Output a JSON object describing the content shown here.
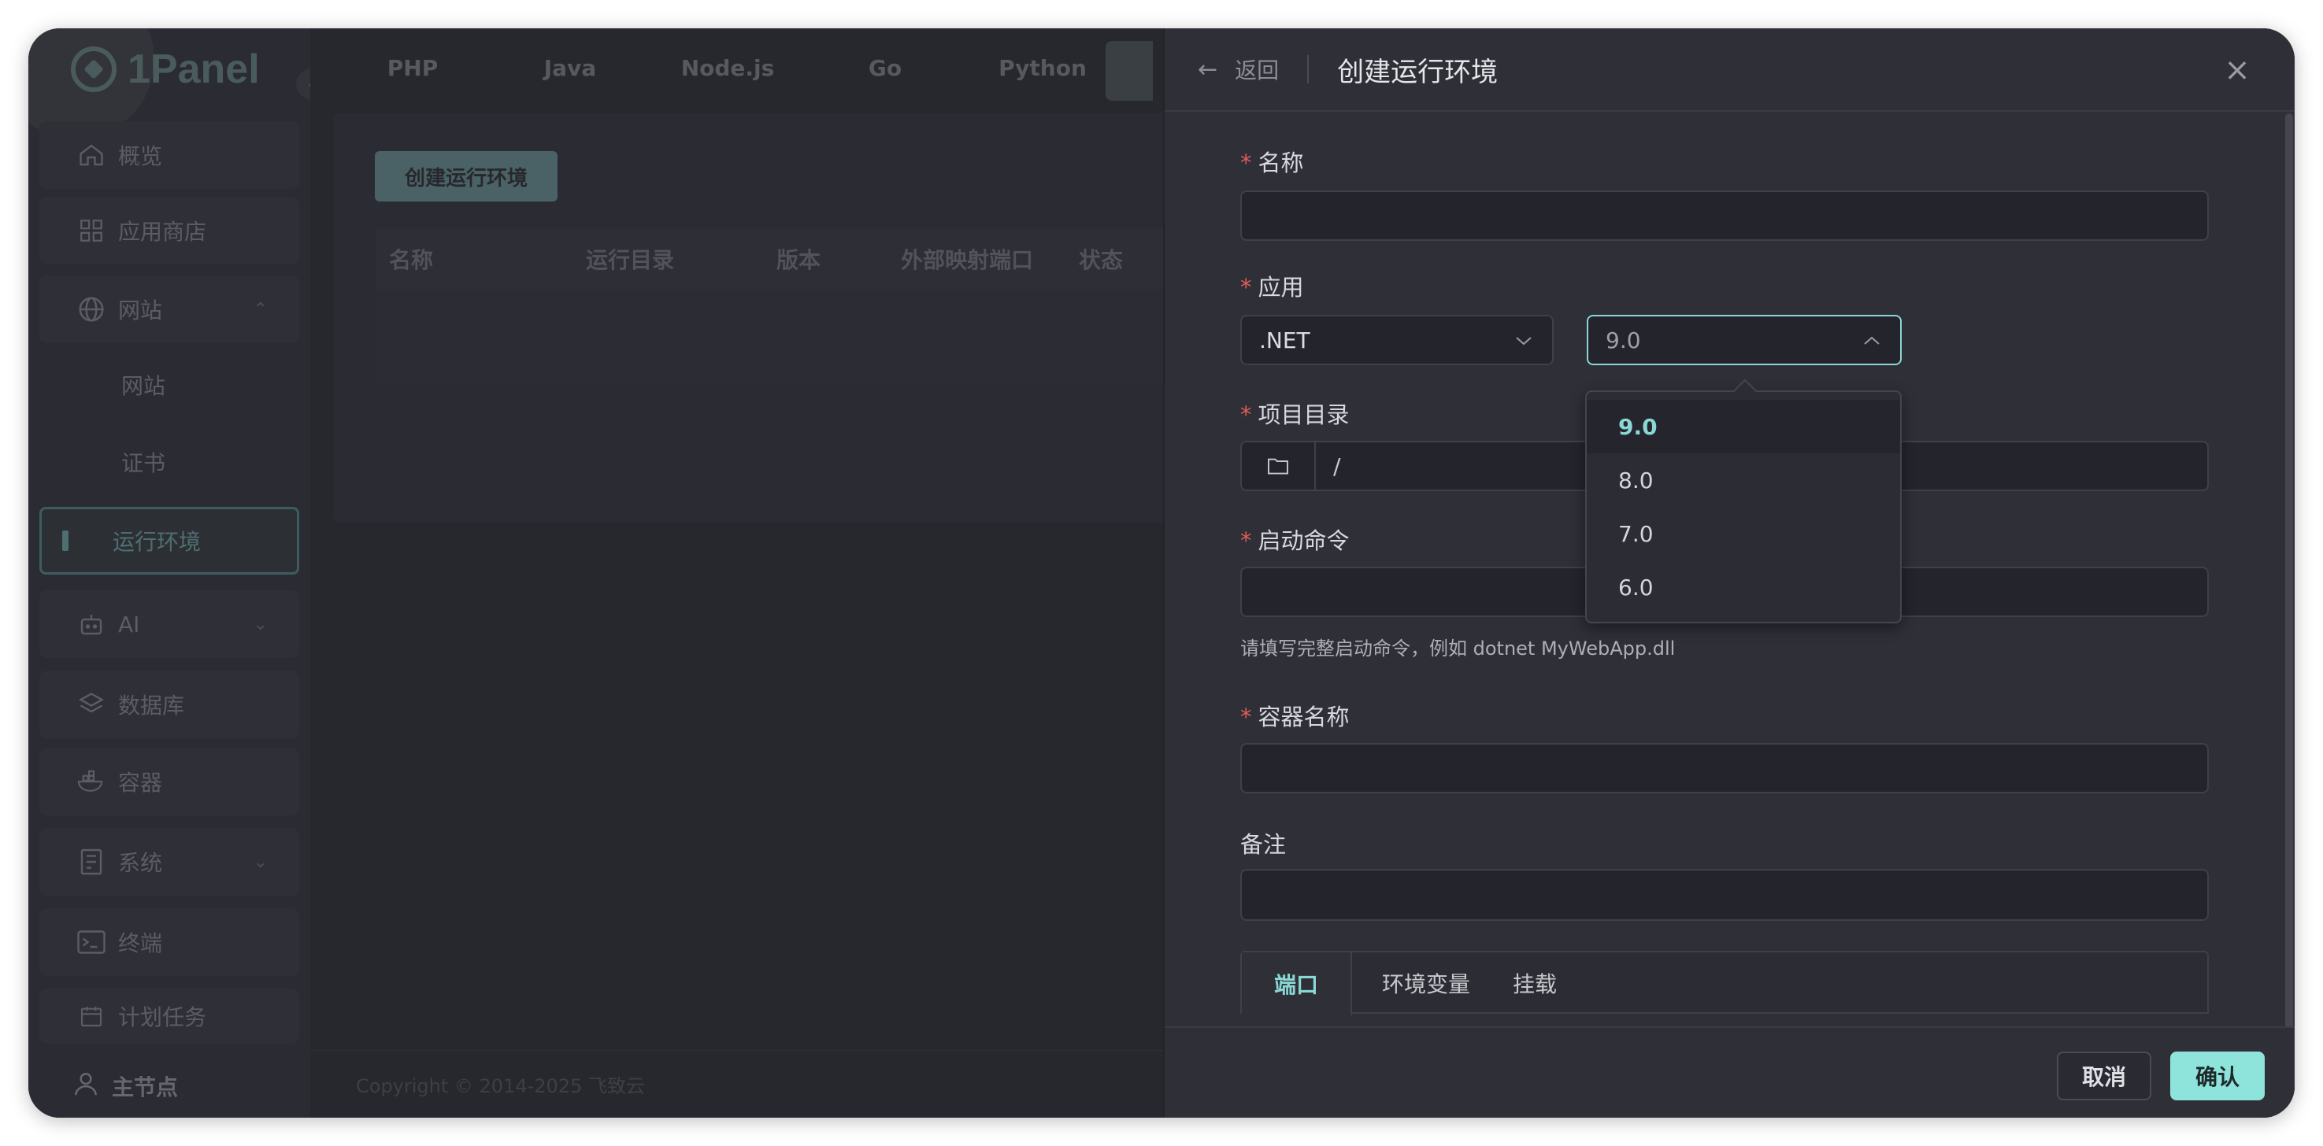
{
  "app": {
    "logo_text": "1Panel"
  },
  "sidebar": {
    "items": [
      {
        "label": "概览",
        "icon": "home-icon"
      },
      {
        "label": "应用商店",
        "icon": "grid-icon"
      },
      {
        "label": "网站",
        "icon": "globe-icon"
      },
      {
        "label": "网站"
      },
      {
        "label": "证书"
      },
      {
        "label": "运行环境"
      },
      {
        "label": "AI",
        "icon": "robot-icon"
      },
      {
        "label": "数据库",
        "icon": "layers-icon"
      },
      {
        "label": "容器",
        "icon": "container-icon"
      },
      {
        "label": "系统",
        "icon": "server-icon"
      },
      {
        "label": "终端",
        "icon": "terminal-icon"
      },
      {
        "label": "计划任务",
        "icon": "calendar-icon"
      }
    ],
    "node_label": "主节点"
  },
  "main": {
    "tabs": [
      "PHP",
      "Java",
      "Node.js",
      "Go",
      "Python"
    ],
    "create_button": "创建运行环境",
    "table_headers": [
      "名称",
      "运行目录",
      "版本",
      "外部映射端口",
      "状态"
    ],
    "footer": "Copyright © 2014-2025 飞致云"
  },
  "drawer": {
    "back_label": "返回",
    "title": "创建运行环境",
    "fields": {
      "name_label": "名称",
      "app_label": "应用",
      "app_value": ".NET",
      "version_value": "9.0",
      "dir_label": "项目目录",
      "dir_value": "/",
      "cmd_label": "启动命令",
      "cmd_hint": "请填写完整启动命令，例如 dotnet MyWebApp.dll",
      "container_label": "容器名称",
      "remark_label": "备注",
      "required_mark": "*"
    },
    "version_options": [
      "9.0",
      "8.0",
      "7.0",
      "6.0"
    ],
    "tabs": [
      "端口",
      "环境变量",
      "挂载"
    ],
    "cancel": "取消",
    "confirm": "确认"
  },
  "colors": {
    "accent": "#8ee3da",
    "required": "#e05b5b"
  }
}
